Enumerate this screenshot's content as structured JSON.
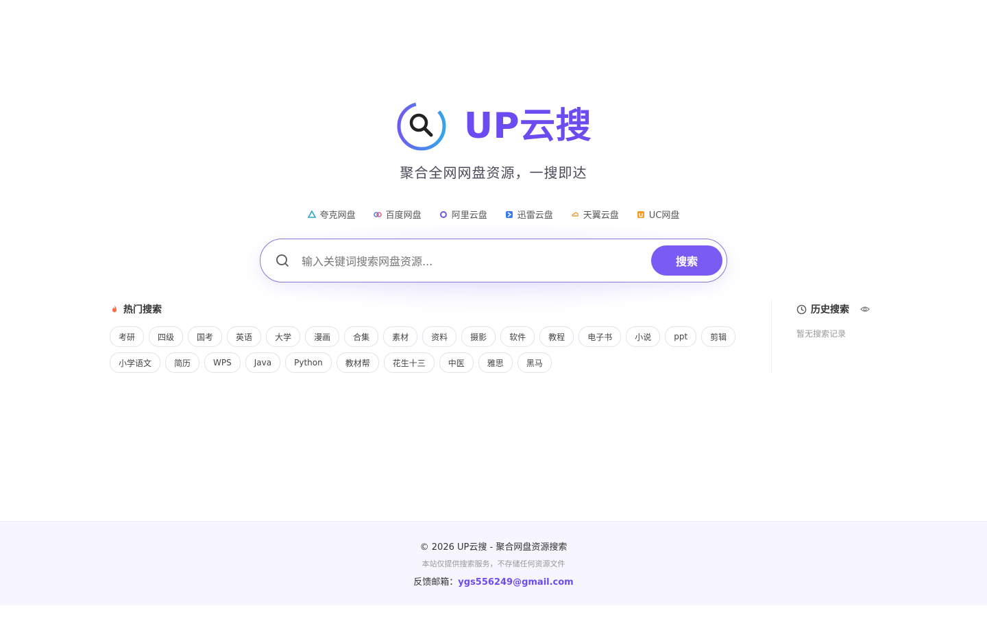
{
  "brand": {
    "name": "UP云搜",
    "tagline": "聚合全网网盘资源，一搜即达",
    "color": "#6c4cf0"
  },
  "providers": [
    {
      "label": "夸克网盘",
      "icon": "quark-icon",
      "color": "#2aa3c8"
    },
    {
      "label": "百度网盘",
      "icon": "baidu-icon",
      "color": "#4a7de0"
    },
    {
      "label": "阿里云盘",
      "icon": "aliyun-icon",
      "color": "#6a5cd8"
    },
    {
      "label": "迅雷云盘",
      "icon": "xunlei-icon",
      "color": "#3b7bf0"
    },
    {
      "label": "天翼云盘",
      "icon": "tianyi-icon",
      "color": "#f29c38"
    },
    {
      "label": "UC网盘",
      "icon": "uc-icon",
      "color": "#f39b25"
    }
  ],
  "search": {
    "placeholder": "输入关键词搜索网盘资源...",
    "value": "",
    "button_label": "搜索"
  },
  "hot": {
    "title": "热门搜索",
    "tags": [
      "考研",
      "四级",
      "国考",
      "英语",
      "大学",
      "漫画",
      "合集",
      "素材",
      "资料",
      "摄影",
      "软件",
      "教程",
      "电子书",
      "小说",
      "ppt",
      "剪辑",
      "小学语文",
      "简历",
      "WPS",
      "Java",
      "Python",
      "教材帮",
      "花生十三",
      "中医",
      "雅思",
      "黑马"
    ]
  },
  "history": {
    "title": "历史搜索",
    "empty": "暂无搜索记录"
  },
  "footer": {
    "copyright": "© 2026 UP云搜 - 聚合网盘资源搜索",
    "note": "本站仅提供搜索服务，不存储任何资源文件",
    "mail_label": "反馈邮箱：",
    "mail": "ygs556249@gmail.com"
  }
}
